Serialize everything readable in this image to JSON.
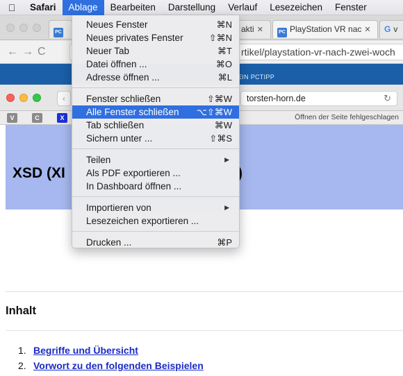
{
  "menubar": {
    "apple_icon": "apple-icon",
    "items": [
      {
        "label": "Safari",
        "app": true
      },
      {
        "label": "Ablage",
        "active": true
      },
      {
        "label": "Bearbeiten"
      },
      {
        "label": "Darstellung"
      },
      {
        "label": "Verlauf"
      },
      {
        "label": "Lesezeichen"
      },
      {
        "label": "Fenster"
      }
    ]
  },
  "back_window": {
    "tabs": [
      {
        "label": "PC"
      },
      {
        "label": "akti"
      },
      {
        "label": "PlayStation VR nac"
      },
      {
        "label": "v"
      }
    ],
    "url_fragment": "rtikel/playstation-vr-nach-zwei-woch",
    "site_bar_text": "EIN PCTIPP"
  },
  "front_window": {
    "url": "torsten-horn.de",
    "bookmarks": [
      {
        "label": "V",
        "color": "#8a8a8a"
      },
      {
        "label": "C",
        "color": "#8a8a8a"
      },
      {
        "label": "X",
        "color": "#1c31d6"
      }
    ],
    "error_text": "Öffnen der Seite fehlgeschlagen"
  },
  "page": {
    "hero_title": "XSD (XI",
    "hero_paren": ")",
    "contents_heading": "Inhalt",
    "toc": [
      {
        "num": "1.",
        "label": "Begriffe und Übersicht"
      },
      {
        "num": "2.",
        "label": "Vorwort zu den folgenden Beispielen"
      }
    ]
  },
  "menu": {
    "groups": [
      [
        {
          "label": "Neues Fenster",
          "shortcut": "⌘N"
        },
        {
          "label": "Neues privates Fenster",
          "shortcut": "⇧⌘N"
        },
        {
          "label": "Neuer Tab",
          "shortcut": "⌘T"
        },
        {
          "label": "Datei öffnen ...",
          "shortcut": "⌘O"
        },
        {
          "label": "Adresse öffnen ...",
          "shortcut": "⌘L"
        }
      ],
      [
        {
          "label": "Fenster schließen",
          "shortcut": "⇧⌘W"
        },
        {
          "label": "Alle Fenster schließen",
          "shortcut": "⌥⇧⌘W",
          "highlighted": true
        },
        {
          "label": "Tab schließen",
          "shortcut": "⌘W"
        },
        {
          "label": "Sichern unter ...",
          "shortcut": "⇧⌘S"
        }
      ],
      [
        {
          "label": "Teilen",
          "submenu": true
        },
        {
          "label": "Als PDF exportieren ..."
        },
        {
          "label": "In Dashboard öffnen ..."
        }
      ],
      [
        {
          "label": "Importieren von",
          "submenu": true
        },
        {
          "label": "Lesezeichen exportieren ..."
        }
      ],
      [
        {
          "label": "Drucken ...",
          "shortcut": "⌘P"
        }
      ]
    ]
  }
}
